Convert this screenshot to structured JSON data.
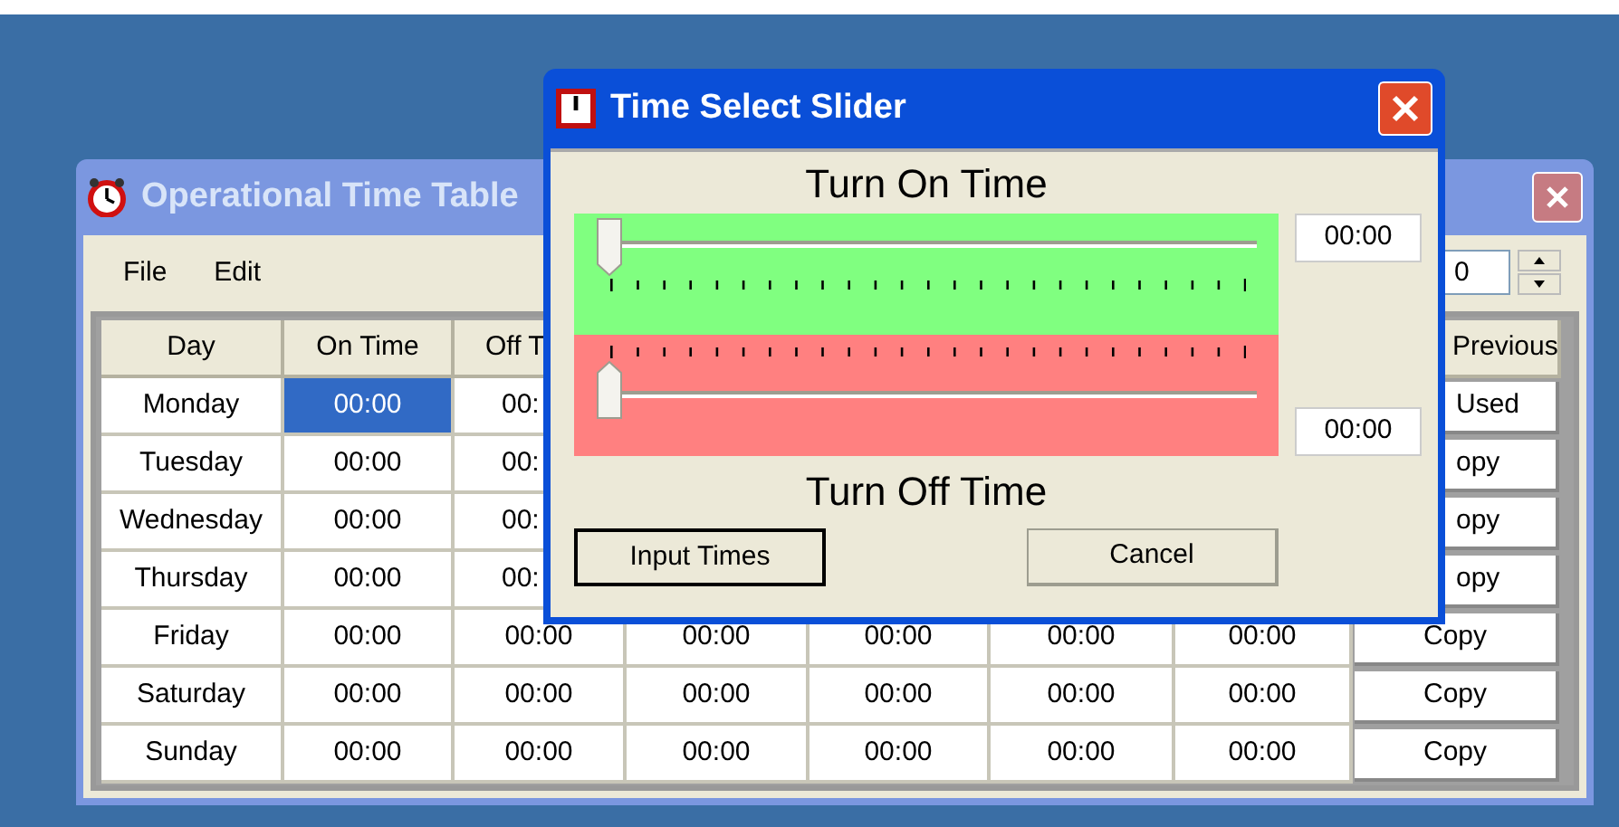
{
  "main_window": {
    "title": "Operational Time Table",
    "active": false,
    "menu": [
      "File",
      "Edit"
    ],
    "spin_value": "0",
    "table": {
      "header": {
        "day": "Day",
        "on_time": "On Time",
        "column_3": "Off T",
        "column_8": "Previous"
      },
      "rows": [
        {
          "day": "Monday",
          "on_time": {
            "text": "00:00",
            "selected": true
          },
          "column_3": "00:",
          "column_8": "Used"
        },
        {
          "day": "Tuesday",
          "on_time": {
            "text": "00:00",
            "selected": false
          },
          "column_3": "00:",
          "column_8": "opy"
        },
        {
          "day": "Wednesday",
          "on_time": {
            "text": "00:00",
            "selected": false
          },
          "column_3": "00:",
          "column_8": "opy"
        },
        {
          "day": "Thursday",
          "on_time": {
            "text": "00:00",
            "selected": false
          },
          "column_3": "00:",
          "column_8": "opy"
        },
        {
          "day": "Friday",
          "on_time": {
            "text": "00:00",
            "selected": false
          },
          "column_3": "00:00",
          "column_4": "00:00",
          "column_5": "00:00",
          "column_6": "00:00",
          "column_7": "00:00",
          "column_8": "Copy"
        },
        {
          "day": "Saturday",
          "on_time": {
            "text": "00:00",
            "selected": false
          },
          "column_3": "00:00",
          "column_4": "00:00",
          "column_5": "00:00",
          "column_6": "00:00",
          "column_7": "00:00",
          "column_8": "Copy"
        },
        {
          "day": "Sunday",
          "on_time": {
            "text": "00:00",
            "selected": false
          },
          "column_3": "00:00",
          "column_4": "00:00",
          "column_5": "00:00",
          "column_6": "00:00",
          "column_7": "00:00",
          "column_8": "Copy"
        }
      ]
    }
  },
  "dialog": {
    "title": "Time Select Slider",
    "active": true,
    "sliders": [
      {
        "kind": "down",
        "label": "Turn On Time",
        "color": "#80ff80",
        "level": 0,
        "reading": "00:00"
      },
      {
        "kind": "up",
        "label": "Turn Off Time",
        "color": "#ff8080",
        "level": 0,
        "reading": "00:00"
      }
    ],
    "buttons": [
      {
        "label": "Input Times",
        "default": true
      },
      {
        "label": "Cancel",
        "default": false
      }
    ]
  }
}
